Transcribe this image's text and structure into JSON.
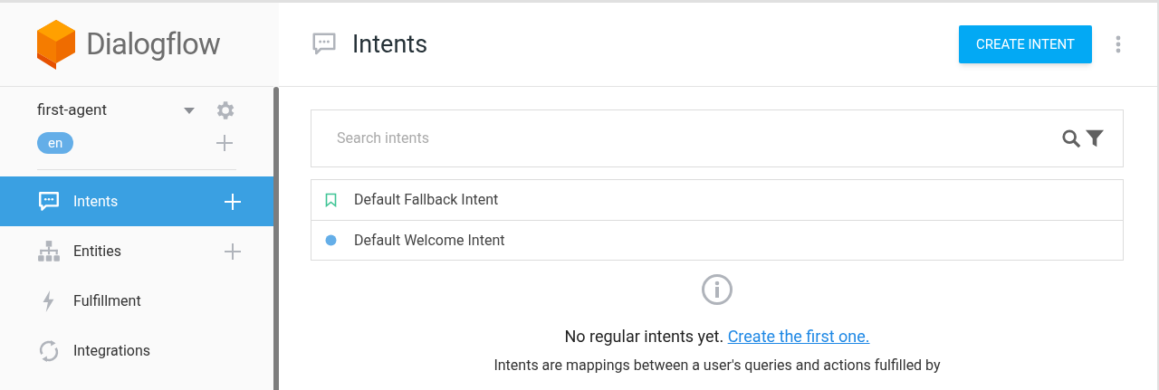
{
  "logo": {
    "text": "Dialogflow"
  },
  "agent": {
    "name": "first-agent",
    "language": "en"
  },
  "nav": [
    {
      "label": "Intents",
      "selected": true,
      "add_button": true
    },
    {
      "label": "Entities",
      "selected": false,
      "add_button": true
    },
    {
      "label": "Fulfillment",
      "selected": false,
      "add_button": false
    },
    {
      "label": "Integrations",
      "selected": false,
      "add_button": false
    }
  ],
  "header": {
    "title": "Intents",
    "button": "CREATE INTENT"
  },
  "search": {
    "placeholder": "Search intents"
  },
  "intents": [
    {
      "name": "Default Fallback Intent",
      "kind": "fallback"
    },
    {
      "name": "Default Welcome Intent",
      "kind": "welcome"
    }
  ],
  "empty": {
    "message": "No regular intents yet.",
    "link": "Create the first one.",
    "description": "Intents are mappings between a user's queries and actions fulfilled by"
  }
}
